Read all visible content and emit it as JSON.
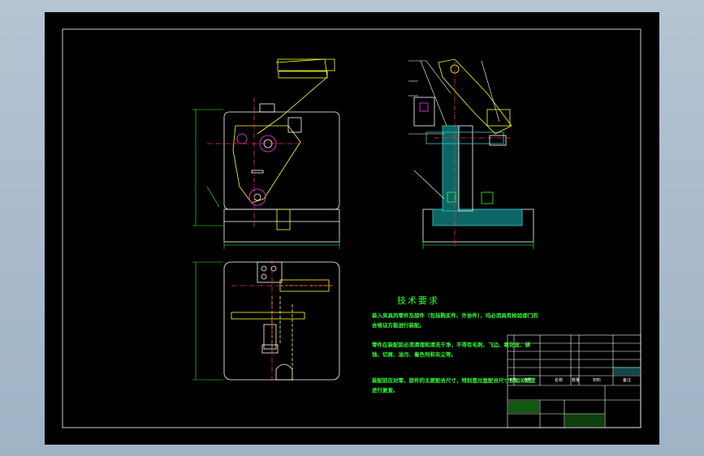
{
  "drawing": {
    "technical_requirements_title": "技术要求",
    "notes": [
      "装入夹具的零件及部件（包括购买件、外协件），均必须具有检验部门的合格证方能进行装配。",
      "零件在装配前必须清理和清洗干净，不得有毛刺、飞边、氧化皮、锈蚀、切屑、油污、着色剂和灰尘等。",
      "装配前应对零、部件的主要配合尺寸，特别是过盈配合尺寸及相关精度进行复查。"
    ],
    "colors": {
      "frame": "#ffffff",
      "outline": "#ffffff",
      "dimension": "#33ff33",
      "centerline": "#ff3333",
      "hidden": "#ffff33",
      "part_highlight": "#ff33ff",
      "hatch": "#33cccc",
      "note_text": "#33ff33"
    },
    "title_block": {
      "header_cells": [
        "序号",
        "代号",
        "名称",
        "数量",
        "材料",
        "备注"
      ]
    }
  }
}
